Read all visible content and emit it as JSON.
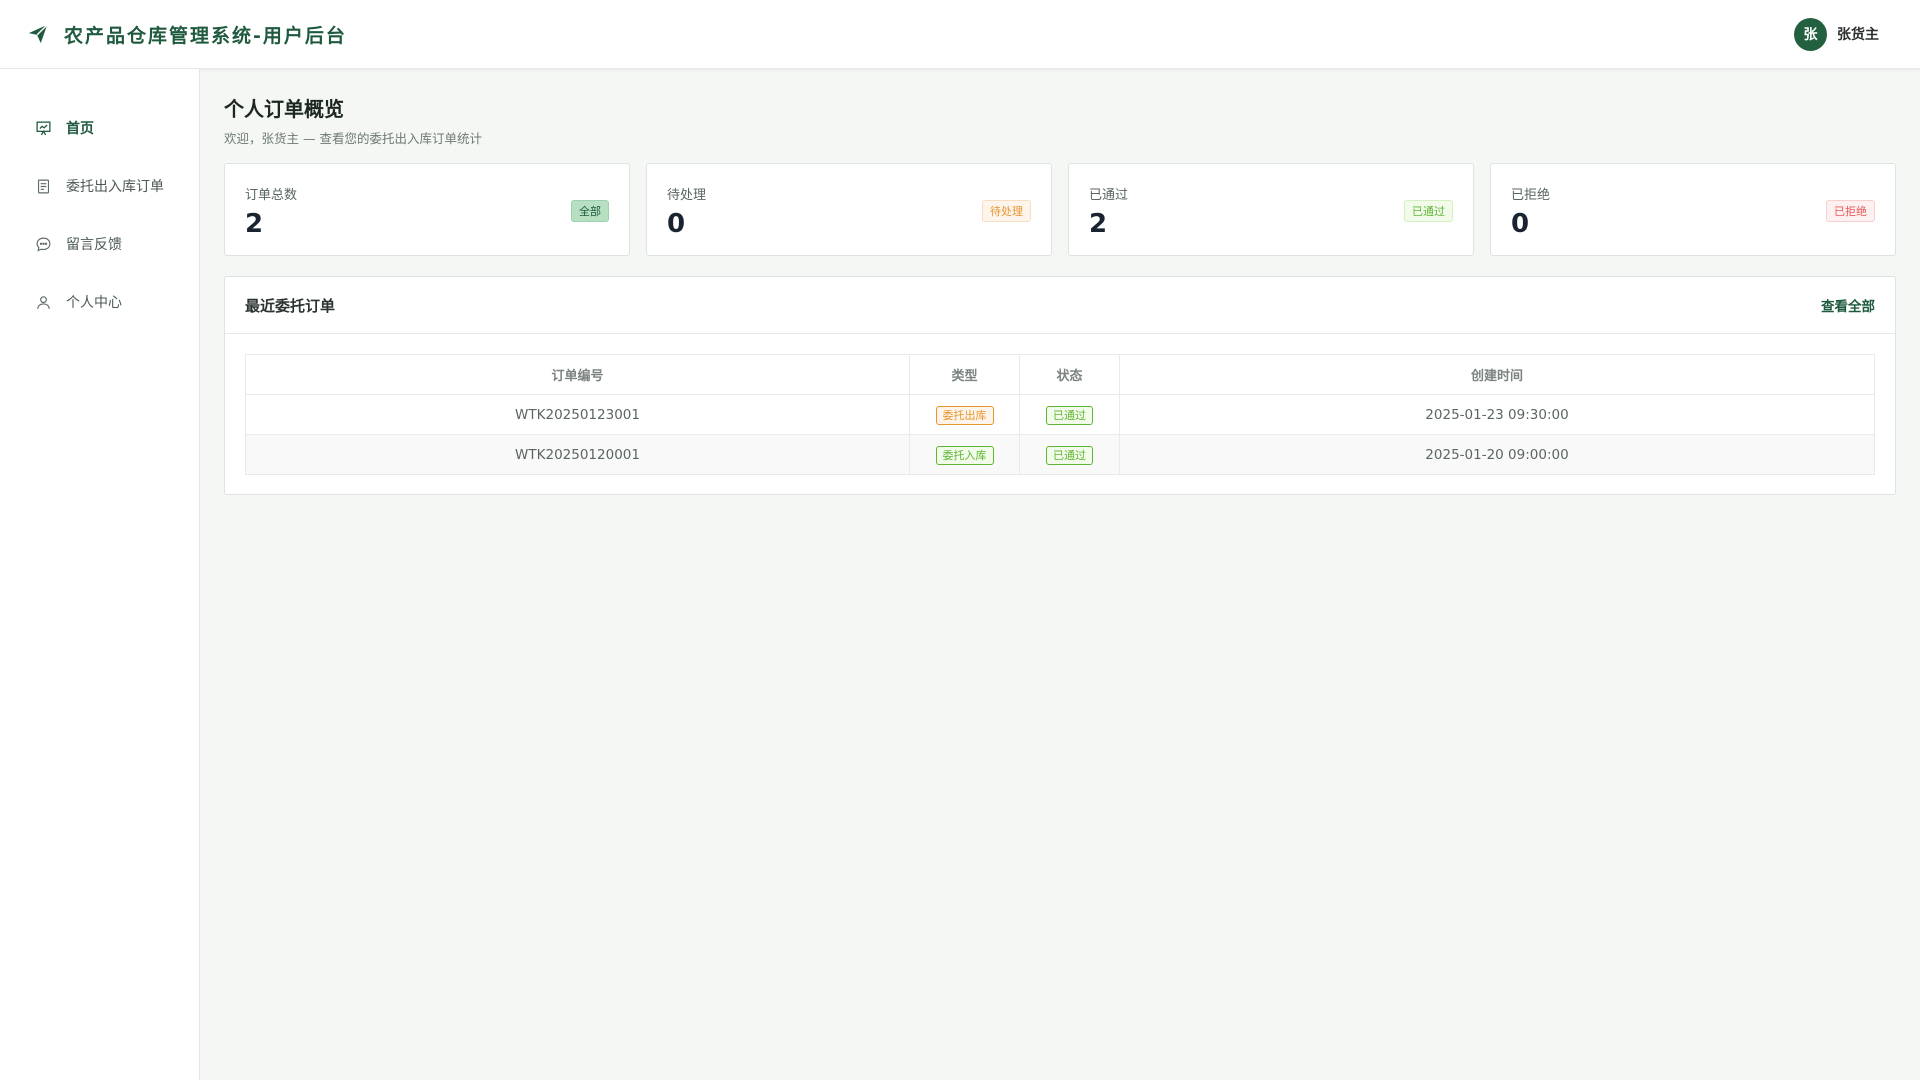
{
  "app": {
    "title": "农产品仓库管理系统-用户后台",
    "logo_icon": "paper-plane-icon",
    "brand_color": "#1f5a3e"
  },
  "user": {
    "avatar_text": "张",
    "name": "张货主"
  },
  "sidebar": {
    "items": [
      {
        "label": "首页",
        "icon": "dashboard-icon",
        "active": true
      },
      {
        "label": "委托出入库订单",
        "icon": "document-icon",
        "active": false
      },
      {
        "label": "留言反馈",
        "icon": "chat-icon",
        "active": false
      },
      {
        "label": "个人中心",
        "icon": "user-icon",
        "active": false
      }
    ]
  },
  "page": {
    "title": "个人订单概览",
    "subtitle": "欢迎，张货主 — 查看您的委托出入库订单统计"
  },
  "stats": [
    {
      "label": "订单总数",
      "value": "2",
      "tag": "全部"
    },
    {
      "label": "待处理",
      "value": "0",
      "tag": "待处理"
    },
    {
      "label": "已通过",
      "value": "2",
      "tag": "已通过"
    },
    {
      "label": "已拒绝",
      "value": "0",
      "tag": "已拒绝"
    }
  ],
  "recent": {
    "title": "最近委托订单",
    "view_all": "查看全部",
    "columns": [
      "订单编号",
      "类型",
      "状态",
      "创建时间"
    ],
    "rows": [
      {
        "order_no": "WTK20250123001",
        "type": "委托出库",
        "status": "已通过",
        "created": "2025-01-23 09:30:00"
      },
      {
        "order_no": "WTK20250120001",
        "type": "委托入库",
        "status": "已通过",
        "created": "2025-01-20 09:00:00"
      }
    ]
  }
}
